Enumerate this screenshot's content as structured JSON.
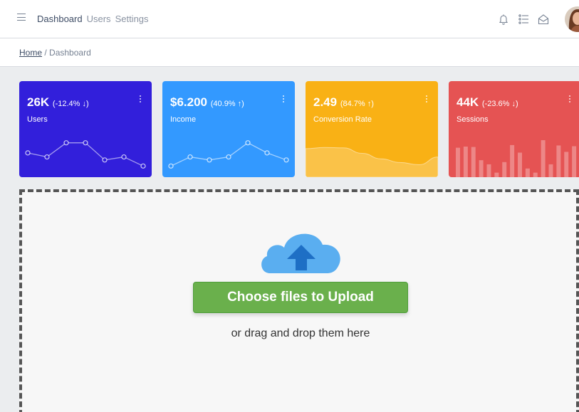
{
  "nav": {
    "items": [
      "Dashboard",
      "Users",
      "Settings"
    ]
  },
  "header_icons": [
    "bell-icon",
    "list-icon",
    "envelope-icon"
  ],
  "breadcrumb": {
    "home": "Home",
    "separator": "/",
    "current": "Dashboard"
  },
  "cards": [
    {
      "value": "26K",
      "change": "(-12.4% ↓)",
      "label": "Users",
      "color": "#321fdb",
      "chart": "line",
      "series": [
        40,
        36,
        50,
        50,
        33,
        36,
        27
      ]
    },
    {
      "value": "$6.200",
      "change": "(40.9% ↑)",
      "label": "Income",
      "color": "#39f",
      "chart": "line",
      "series": [
        27,
        36,
        33,
        36,
        50,
        40,
        33
      ]
    },
    {
      "value": "2.49",
      "change": "(84.7% ↑)",
      "label": "Conversion Rate",
      "color": "#f9b115",
      "chart": "area",
      "series": [
        78,
        81,
        80,
        65,
        50,
        40,
        34,
        55
      ]
    },
    {
      "value": "44K",
      "change": "(-23.6% ↓)",
      "label": "Sessions",
      "color": "#e55353",
      "chart": "bar",
      "series": [
        78,
        81,
        80,
        45,
        34,
        12,
        40,
        85,
        65,
        23,
        12,
        98,
        34,
        84,
        67,
        82
      ]
    }
  ],
  "upload": {
    "button_label": "Choose files to Upload",
    "hint": "or drag and drop them here",
    "button_color": "#6ab04c",
    "cloud_color": "#5aaef0",
    "arrow_color": "#1e6fc5"
  }
}
